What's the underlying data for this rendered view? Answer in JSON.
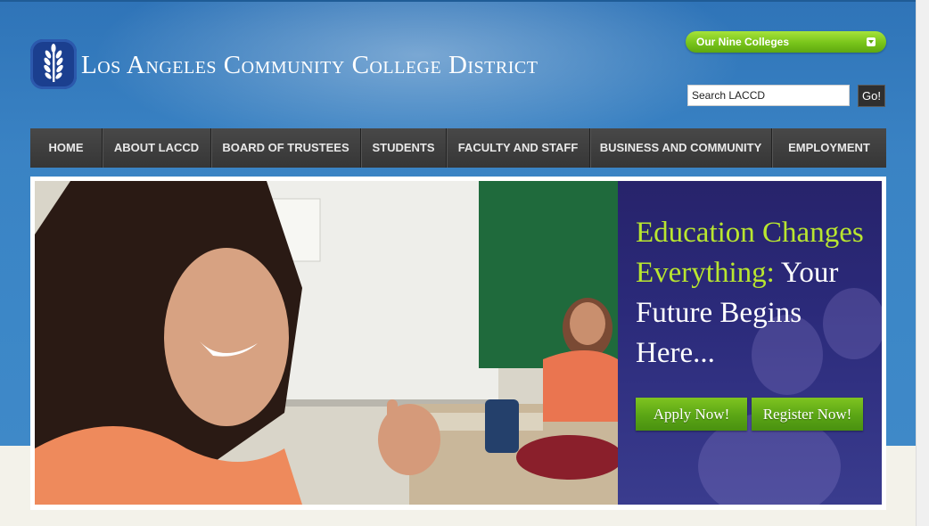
{
  "header": {
    "site_title": "Los Angeles Community College District",
    "colleges_dropdown": {
      "label": "Our Nine Colleges"
    },
    "search": {
      "value": "Search LACCD",
      "button_label": "Go!"
    }
  },
  "nav": {
    "items": [
      {
        "label": "HOME"
      },
      {
        "label": "ABOUT LACCD"
      },
      {
        "label": "BOARD OF TRUSTEES"
      },
      {
        "label": "STUDENTS"
      },
      {
        "label": "FACULTY AND STAFF"
      },
      {
        "label": "BUSINESS AND COMMUNITY"
      },
      {
        "label": "EMPLOYMENT"
      }
    ]
  },
  "hero": {
    "headline_part1": "Education Changes Everything:",
    "headline_part2": "Your Future Begins Here...",
    "apply_label": "Apply Now!",
    "register_label": "Register Now!"
  },
  "colors": {
    "background_blue": "#3c87c7",
    "nav_dark": "#3a3a3a",
    "accent_green": "#7fc420",
    "panel_navy": "#2b2a7a",
    "headline_green": "#b9e62f"
  },
  "icons": {
    "logo": "wheat-stalk-icon",
    "dropdown": "chevron-down-icon"
  }
}
